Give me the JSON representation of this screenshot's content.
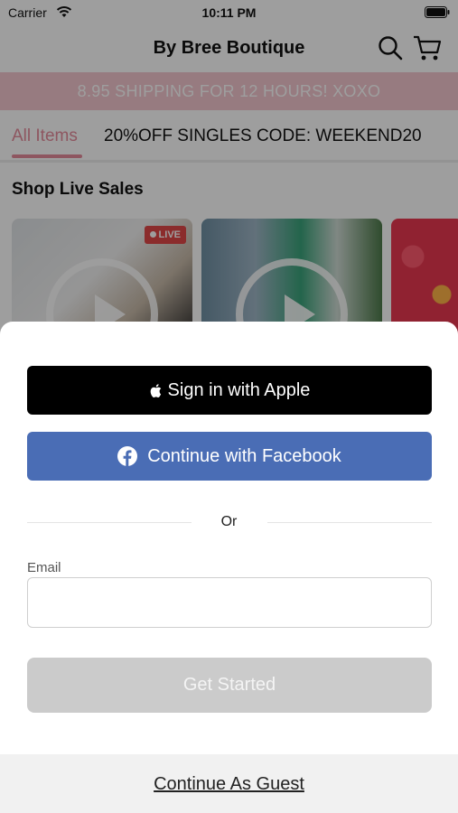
{
  "status_bar": {
    "carrier": "Carrier",
    "time": "10:11 PM"
  },
  "header": {
    "title": "By Bree Boutique",
    "icons": [
      "search-icon",
      "cart-icon"
    ]
  },
  "promo_banner": {
    "text": "8.95 SHIPPING FOR 12 HOURS! XOXO"
  },
  "tabs": [
    {
      "label": "All Items",
      "active": true
    },
    {
      "label": "20%OFF SINGLES CODE: WEEKEND20",
      "active": false
    }
  ],
  "live_sales": {
    "title": "Shop Live Sales",
    "badge": "LIVE"
  },
  "sheet": {
    "apple_label": "Sign in with Apple",
    "facebook_label": "Continue with Facebook",
    "or_label": "Or",
    "email_label": "Email",
    "email_value": "",
    "get_started_label": "Get Started",
    "guest_label": "Continue As Guest"
  },
  "colors": {
    "accent_pink": "#e58b9b",
    "promo_bg": "#f4c7cf",
    "facebook_blue": "#4a6db5",
    "apple_black": "#000000",
    "disabled_gray": "#cbcbcb"
  }
}
